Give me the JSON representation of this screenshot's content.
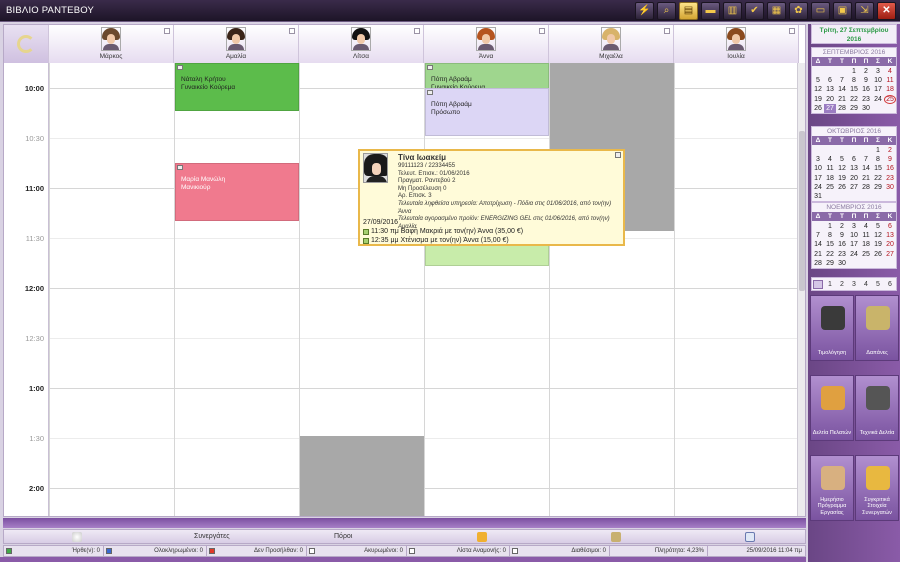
{
  "window": {
    "title": "ΒΙΒΛΙΟ ΡΑΝΤΕΒΟΥ"
  },
  "toolbar": {
    "buttons": [
      {
        "icon": "lightning-icon",
        "glyph": "⚡"
      },
      {
        "icon": "search-icon",
        "glyph": "⌕"
      },
      {
        "icon": "calendar-book-icon",
        "glyph": "▤"
      },
      {
        "icon": "card-icon",
        "glyph": "▬"
      },
      {
        "icon": "clipboard-icon",
        "glyph": "▥"
      },
      {
        "icon": "checklist-icon",
        "glyph": "✔"
      },
      {
        "icon": "grid-calendar-icon",
        "glyph": "▦"
      },
      {
        "icon": "settings-icon",
        "glyph": "✿"
      },
      {
        "icon": "minimize-icon",
        "glyph": "▭"
      },
      {
        "icon": "lock-icon",
        "glyph": "▣"
      },
      {
        "icon": "export-icon",
        "glyph": "⇲"
      },
      {
        "icon": "close-icon",
        "glyph": "✕"
      }
    ]
  },
  "staff": [
    {
      "name": "Μάρκος",
      "hair": "#6b4a2e"
    },
    {
      "name": "Αμαλία",
      "hair": "#3a2418"
    },
    {
      "name": "Λίτσα",
      "hair": "#121212"
    },
    {
      "name": "Άννα",
      "hair": "#b5541f"
    },
    {
      "name": "Μιχαέλα",
      "hair": "#d8b36a"
    },
    {
      "name": "Ιουλία",
      "hair": "#8a4a1e"
    }
  ],
  "times": [
    "10:00",
    "10:30",
    "11:00",
    "11:30",
    "12:00",
    "12:30",
    "1:00",
    "1:30",
    "2:00"
  ],
  "appointments": [
    {
      "col": 1,
      "start": 0,
      "dur": 0.5,
      "color": "#5cbc4b",
      "line1": "Νάταλη Κρήτου",
      "line2": "Γυναικείο Κούρεμα"
    },
    {
      "col": 3,
      "start": 0,
      "dur": 0.5,
      "color": "#9fd68e",
      "line1": "Πόπη Αβραάμ",
      "line2": "Γυναικείο Κούρεμα"
    },
    {
      "col": 3,
      "start": 0.5,
      "dur": 0.5,
      "color": "#dcd6f5",
      "line1": "Πόπη Αβραάμ",
      "line2": "Πρόσωπο"
    },
    {
      "col": 1,
      "start": 2,
      "dur": 0.6,
      "color": "#f07a8e",
      "line1": "Μαρία Μανώλη",
      "line2": "Μανικιούρ",
      "textColor": "#fff"
    },
    {
      "col": 3,
      "start": 2,
      "dur": 0.5,
      "color": "#f2d5a8",
      "line1": "Τίνα Ιωακείμ",
      "line2": "Βαφή Μακριά"
    },
    {
      "col": 3,
      "start": 3.1,
      "dur": 0.5,
      "color": "#c8ecaa",
      "line1": "Τίνα Ιωακείμ",
      "line2": "Χτένισμα"
    }
  ],
  "popup": {
    "name": "Τίνα Ιωακείμ",
    "phones": "99111123 / 22334455",
    "last_visit": "Τελευτ. Επισκ.: 01/06/2016",
    "booked": "Πραγματ. Ραντεβού 2",
    "noshow": "Μη Προσέλευση 0",
    "visits": "Αρ. Επισκ. 3",
    "last_service": "Τελευταία ληφθείσα υπηρεσία: Αποτρίχωση - Πόδια στις 01/06/2016, από τον(ην) Άννα",
    "last_product": "Τελευταία αγορασμένο προϊόν: ENERGIZING GEL στις 01/06/2016, από τον(ην) Αμαλία",
    "date": "27/09/2016",
    "line_a": "11:30 πμ Βαφή Μακριά με τον(ην) Άννα (35,00 €)",
    "line_b": "12:35 μμ Χτένισμα με τον(ην) Άννα (15,00 €)"
  },
  "rightpanel": {
    "today": "Τρίτη, 27 Σεπτεμβρίου 2016",
    "dow": [
      "Δ",
      "Τ",
      "Τ",
      "Π",
      "Π",
      "Σ",
      "Κ"
    ],
    "months": [
      {
        "name": "ΣΕΠΤΕΜΒΡΙΟΣ 2016",
        "rows": [
          [
            "",
            "",
            "",
            "1",
            "2",
            "3",
            "4"
          ],
          [
            "5",
            "6",
            "7",
            "8",
            "9",
            "10",
            "11"
          ],
          [
            "12",
            "13",
            "14",
            "15",
            "16",
            "17",
            "18"
          ],
          [
            "19",
            "20",
            "21",
            "22",
            "23",
            "24",
            "25"
          ],
          [
            "26",
            "27",
            "28",
            "29",
            "30",
            "",
            ""
          ]
        ],
        "selected": "27",
        "today": "25"
      },
      {
        "name": "ΟΚΤΩΒΡΙΟΣ 2016",
        "rows": [
          [
            "",
            "",
            "",
            "",
            "",
            "1",
            "2"
          ],
          [
            "3",
            "4",
            "5",
            "6",
            "7",
            "8",
            "9"
          ],
          [
            "10",
            "11",
            "12",
            "13",
            "14",
            "15",
            "16"
          ],
          [
            "17",
            "18",
            "19",
            "20",
            "21",
            "22",
            "23"
          ],
          [
            "24",
            "25",
            "26",
            "27",
            "28",
            "29",
            "30"
          ],
          [
            "31",
            "",
            "",
            "",
            "",
            "",
            ""
          ]
        ]
      },
      {
        "name": "ΝΟΕΜΒΡΙΟΣ 2016",
        "rows": [
          [
            "",
            "1",
            "2",
            "3",
            "4",
            "5",
            "6"
          ],
          [
            "7",
            "8",
            "9",
            "10",
            "11",
            "12",
            "13"
          ],
          [
            "14",
            "15",
            "16",
            "17",
            "18",
            "19",
            "20"
          ],
          [
            "21",
            "22",
            "23",
            "24",
            "25",
            "26",
            "27"
          ],
          [
            "28",
            "29",
            "30",
            "",
            "",
            "",
            ""
          ]
        ]
      }
    ],
    "pager": [
      "1",
      "2",
      "3",
      "4",
      "5",
      "6"
    ],
    "tiles": [
      {
        "label": "Τιμολόγηση",
        "icon": "invoice-icon",
        "color": "#3a3a3a"
      },
      {
        "label": "Δαπάνες",
        "icon": "purse-icon",
        "color": "#c9b46a"
      },
      {
        "label": "Δελτία Πελατών",
        "icon": "customers-icon",
        "color": "#e0a040"
      },
      {
        "label": "Τεχνικά Δελτία",
        "icon": "technical-sheet-icon",
        "color": "#555"
      },
      {
        "label": "Ημερήσιο Πρόγραμμα Εργασίας",
        "icon": "hourglass-icon",
        "color": "#d8b080"
      },
      {
        "label": "Συγκριτικά Στοιχεία Συνεργατών",
        "icon": "compare-search-icon",
        "color": "#e8b840"
      }
    ]
  },
  "tabs": {
    "staff": "Συνεργάτες",
    "resources": "Πόροι"
  },
  "status": {
    "checked": "Ήρθε(ν): 0",
    "completed": "Ολοκληρωμένοι: 0",
    "noshow": "Δεν Προσήλθαν: 0",
    "cancelled": "Ακυρωμένοι: 0",
    "waiting": "Λίστα Αναμονής: 0",
    "available": "Διαθέσιμοι: 0",
    "occupancy": "Πληρότητα: 4,23%",
    "datetime": "25/09/2016 11:04 πμ"
  }
}
